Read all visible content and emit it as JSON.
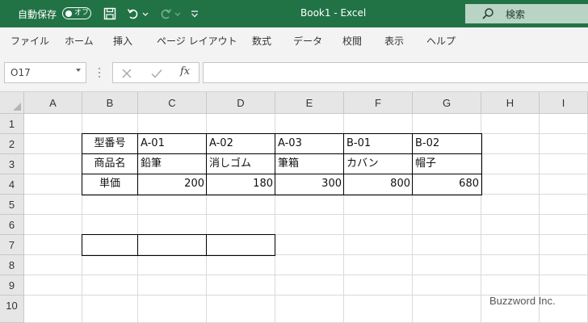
{
  "titlebar": {
    "autosave_label": "自動保存",
    "autosave_state": "オフ",
    "document_title": "Book1 - Excel",
    "search_placeholder": "検索",
    "icons": [
      "save-icon",
      "undo-icon",
      "redo-icon",
      "customize-qat-icon",
      "search-icon"
    ],
    "bg_color": "#217346"
  },
  "menu": {
    "items": [
      "ファイル",
      "ホーム",
      "挿入",
      "ページ レイアウト",
      "数式",
      "データ",
      "校閲",
      "表示",
      "ヘルプ"
    ]
  },
  "formula_bar": {
    "name_box": "O17",
    "fx": "fx",
    "formula": ""
  },
  "sheet": {
    "columns": [
      "A",
      "B",
      "C",
      "D",
      "E",
      "F",
      "G",
      "H",
      "I"
    ],
    "rows": [
      "1",
      "2",
      "3",
      "4",
      "5",
      "6",
      "7",
      "8",
      "9",
      "10"
    ],
    "table": {
      "row2": [
        "型番号",
        "A-01",
        "A-02",
        "A-03",
        "B-01",
        "B-02"
      ],
      "row3": [
        "商品名",
        "鉛筆",
        "消しゴム",
        "筆箱",
        "カバン",
        "帽子"
      ],
      "row4": [
        "単価",
        "200",
        "180",
        "300",
        "800",
        "680"
      ]
    }
  },
  "watermark": "Buzzword Inc."
}
